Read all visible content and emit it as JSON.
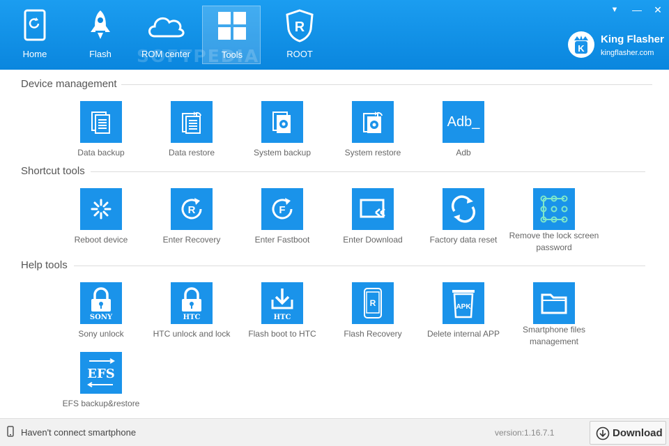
{
  "nav": {
    "items": [
      {
        "label": "Home",
        "icon": "phone-refresh-icon"
      },
      {
        "label": "Flash",
        "icon": "rocket-icon"
      },
      {
        "label": "ROM center",
        "icon": "cloud-icon"
      },
      {
        "label": "Tools",
        "icon": "grid-icon",
        "active": true
      },
      {
        "label": "ROOT",
        "icon": "shield-r-icon"
      }
    ],
    "watermark": "SOFTPEDIA"
  },
  "window": {
    "dropdown_glyph": "▼",
    "minimize_glyph": "—",
    "close_glyph": "✕"
  },
  "brand": {
    "name": "King Flasher",
    "site": "kingflasher.com",
    "logo_letter": "K"
  },
  "sections": [
    {
      "title": "Device management",
      "tools": [
        {
          "label": "Data backup",
          "icon": "data-backup-icon"
        },
        {
          "label": "Data restore",
          "icon": "data-restore-icon"
        },
        {
          "label": "System backup",
          "icon": "system-backup-icon"
        },
        {
          "label": "System restore",
          "icon": "system-restore-icon"
        },
        {
          "label": "Adb",
          "icon": "adb-icon",
          "icon_text": "Adb_"
        }
      ]
    },
    {
      "title": "Shortcut tools",
      "tools": [
        {
          "label": "Reboot device",
          "icon": "reboot-icon"
        },
        {
          "label": "Enter Recovery",
          "icon": "recovery-icon",
          "icon_text": "R"
        },
        {
          "label": "Enter Fastboot",
          "icon": "fastboot-icon",
          "icon_text": "F"
        },
        {
          "label": "Enter Download",
          "icon": "download-mode-icon"
        },
        {
          "label": "Factory data reset",
          "icon": "factory-reset-icon"
        },
        {
          "label": "Remove the lock screen password",
          "icon": "pattern-lock-icon"
        }
      ]
    },
    {
      "title": "Help tools",
      "tools": [
        {
          "label": "Sony unlock",
          "icon": "sony-lock-icon",
          "icon_text": "SONY"
        },
        {
          "label": "HTC unlock and lock",
          "icon": "htc-lock-icon",
          "icon_text": "HTC"
        },
        {
          "label": "Flash boot to HTC",
          "icon": "htc-flash-icon",
          "icon_text": "HTC"
        },
        {
          "label": "Flash Recovery",
          "icon": "flash-recovery-icon",
          "icon_text": "R"
        },
        {
          "label": "Delete internal APP",
          "icon": "apk-trash-icon",
          "icon_text": "APK"
        },
        {
          "label": "Smartphone files management",
          "icon": "folder-icon"
        },
        {
          "label": "EFS backup&restore",
          "icon": "efs-icon",
          "icon_text": "EFS"
        }
      ]
    }
  ],
  "status": {
    "connection": "Haven't connect smartphone",
    "version": "version:1.16.7.1",
    "download_label": "Download"
  },
  "colors": {
    "accent": "#1a93ea",
    "topbar": "#0a86de"
  }
}
